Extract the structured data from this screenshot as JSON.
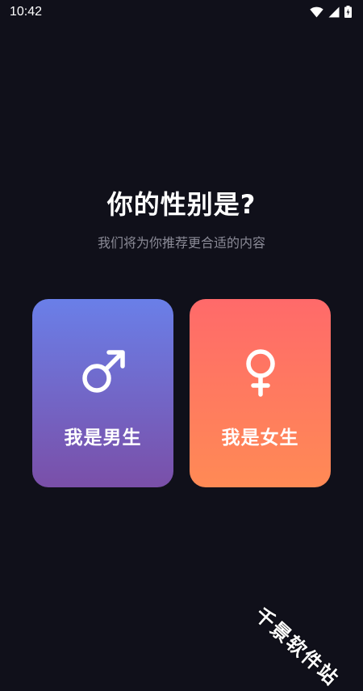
{
  "status_bar": {
    "time": "10:42",
    "icons": [
      "wifi-icon",
      "signal-icon",
      "battery-icon"
    ]
  },
  "page": {
    "title": "你的性别是?",
    "subtitle": "我们将为你推荐更合适的内容"
  },
  "options": {
    "male": {
      "label": "我是男生",
      "icon": "male-symbol-icon",
      "gradient": [
        "#6a7fe8",
        "#7a4fa8"
      ]
    },
    "female": {
      "label": "我是女生",
      "icon": "female-symbol-icon",
      "gradient": [
        "#ff6a6a",
        "#ff8a55"
      ]
    }
  },
  "watermark": {
    "text": "千景软件站"
  },
  "colors": {
    "background": "#10101a",
    "subtitle": "#8a8a96"
  }
}
